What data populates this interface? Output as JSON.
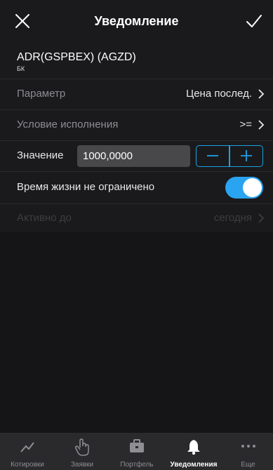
{
  "header": {
    "title": "Уведомление",
    "close_icon": "close-icon",
    "confirm_icon": "checkmark-icon"
  },
  "instrument": {
    "name": "ADR(GSPBEX) (AGZD)",
    "exchange": "БК"
  },
  "form": {
    "parameter": {
      "label": "Параметр",
      "value": "Цена послед."
    },
    "condition": {
      "label": "Условие исполнения",
      "value": ">="
    },
    "amount": {
      "label": "Значение",
      "value": "1000,0000",
      "minus": "−",
      "plus": "+"
    },
    "unlimited": {
      "label": "Время жизни не ограничено",
      "enabled": true
    },
    "active_until": {
      "label": "Активно до",
      "value": "сегодня",
      "disabled": true
    }
  },
  "tabbar": {
    "items": [
      {
        "label": "Котировки",
        "icon": "chart-line-icon",
        "active": false
      },
      {
        "label": "Заявки",
        "icon": "hand-icon",
        "active": false
      },
      {
        "label": "Портфель",
        "icon": "briefcase-icon",
        "active": false
      },
      {
        "label": "Уведомления",
        "icon": "bell-icon",
        "active": true
      },
      {
        "label": "Еще",
        "icon": "more-icon",
        "active": false
      }
    ]
  },
  "colors": {
    "accent": "#2aa3f0",
    "background": "#000000",
    "panel": "#1a1a1c",
    "tabbar": "#2a2a2d"
  }
}
